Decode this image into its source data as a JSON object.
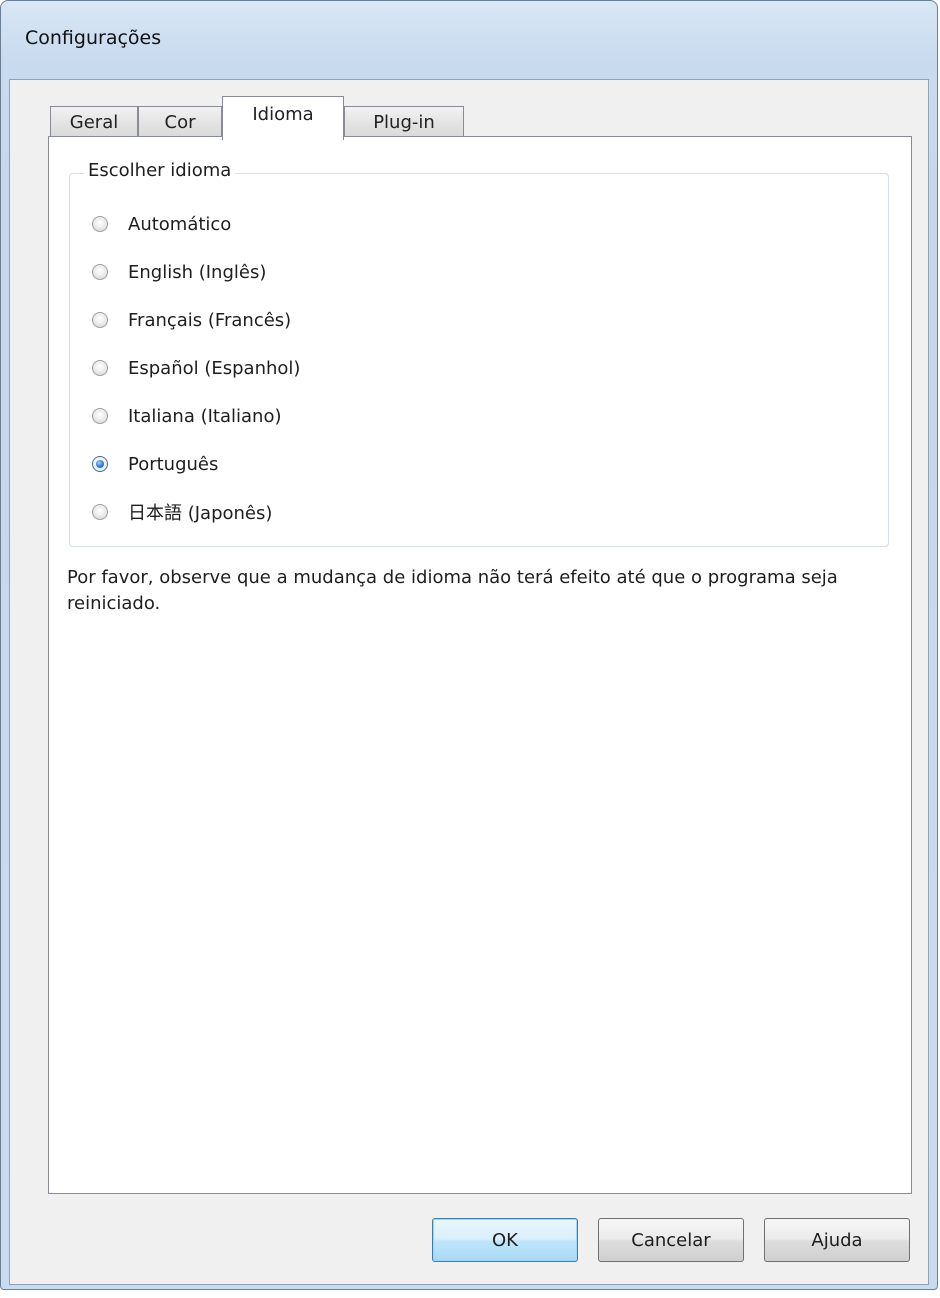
{
  "window": {
    "title": "Configurações"
  },
  "tabs": [
    {
      "label": "Geral",
      "active": false
    },
    {
      "label": "Cor",
      "active": false
    },
    {
      "label": "Idioma",
      "active": true
    },
    {
      "label": "Plug-in",
      "active": false
    }
  ],
  "language_group": {
    "legend": "Escolher idioma",
    "options": [
      {
        "label": "Automático",
        "checked": false
      },
      {
        "label": "English (Inglês)",
        "checked": false
      },
      {
        "label": "Français (Francês)",
        "checked": false
      },
      {
        "label": "Español (Espanhol)",
        "checked": false
      },
      {
        "label": "Italiana (Italiano)",
        "checked": false
      },
      {
        "label": "Português",
        "checked": true
      },
      {
        "label": "日本語 (Japonês)",
        "checked": false
      }
    ]
  },
  "note": "Por favor, observe que a mudança de idioma não terá efeito até que o programa seja reiniciado.",
  "buttons": {
    "ok": "OK",
    "cancel": "Cancelar",
    "help": "Ajuda"
  },
  "colors": {
    "title_bar": "#c8daee",
    "default_button_border": "#3c7fb1",
    "radio_selected_dot": "#2f7bd0"
  }
}
